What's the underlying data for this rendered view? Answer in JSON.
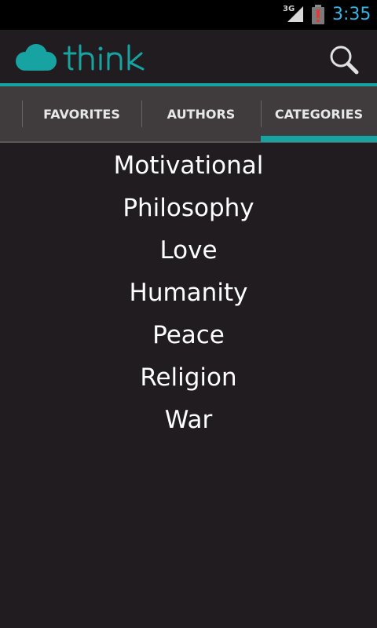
{
  "status_bar": {
    "network": "3G",
    "time": "3:35",
    "battery_color": "#c62828",
    "clock_color": "#33b5e5",
    "icons": [
      "signal-icon",
      "battery-low-icon"
    ]
  },
  "app": {
    "name": "think",
    "brand_color": "#17a3a1",
    "search_icon": "search-icon"
  },
  "tabs": [
    {
      "label": "FAVORITES",
      "selected": false
    },
    {
      "label": "AUTHORS",
      "selected": false
    },
    {
      "label": "CATEGORIES",
      "selected": true
    }
  ],
  "categories": [
    "Motivational",
    "Philosophy",
    "Love",
    "Humanity",
    "Peace",
    "Religion",
    "War"
  ]
}
